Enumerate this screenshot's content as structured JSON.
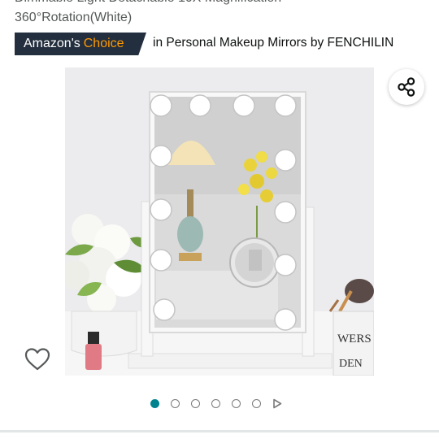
{
  "product": {
    "title_line1": "Dimmable Light Detachable 10X Magnification",
    "title_line2": "360°Rotation(White)"
  },
  "badge": {
    "label_part1": "Amazon's",
    "label_part2": "Choice",
    "category_text": "in Personal Makeup Mirrors by FENCHILIN",
    "bg_color": "#232f3e",
    "accent_color": "#ff9900"
  },
  "image": {
    "box_text_line1": "WERS",
    "box_text_line2": "DEN"
  },
  "actions": {
    "share_icon": "share-icon",
    "wishlist_icon": "heart-outline-icon"
  },
  "carousel": {
    "total_images": 6,
    "active_index": 0,
    "has_video": true,
    "active_color": "#00838f"
  }
}
